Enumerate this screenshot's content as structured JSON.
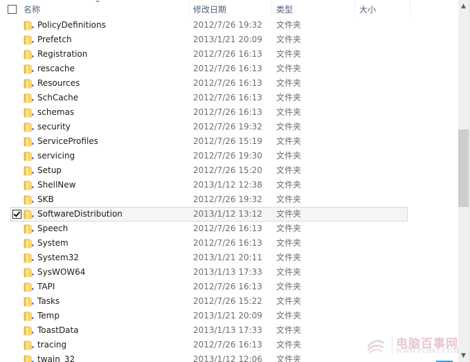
{
  "header": {
    "select_all_checked": false,
    "columns": {
      "name": "名称",
      "date": "修改日期",
      "type": "类型",
      "size": "大小"
    },
    "sort_column": "name",
    "sort_direction": "ascending"
  },
  "rows": [
    {
      "name": "PolicyDefinitions",
      "date": "2012/7/26 19:32",
      "type": "文件夹",
      "size": "",
      "selected": false
    },
    {
      "name": "Prefetch",
      "date": "2013/1/21 20:09",
      "type": "文件夹",
      "size": "",
      "selected": false
    },
    {
      "name": "Registration",
      "date": "2012/7/26 16:13",
      "type": "文件夹",
      "size": "",
      "selected": false
    },
    {
      "name": "rescache",
      "date": "2012/7/26 16:13",
      "type": "文件夹",
      "size": "",
      "selected": false
    },
    {
      "name": "Resources",
      "date": "2012/7/26 16:13",
      "type": "文件夹",
      "size": "",
      "selected": false
    },
    {
      "name": "SchCache",
      "date": "2012/7/26 16:13",
      "type": "文件夹",
      "size": "",
      "selected": false
    },
    {
      "name": "schemas",
      "date": "2012/7/26 16:13",
      "type": "文件夹",
      "size": "",
      "selected": false
    },
    {
      "name": "security",
      "date": "2012/7/26 19:32",
      "type": "文件夹",
      "size": "",
      "selected": false
    },
    {
      "name": "ServiceProfiles",
      "date": "2012/7/26 15:19",
      "type": "文件夹",
      "size": "",
      "selected": false
    },
    {
      "name": "servicing",
      "date": "2012/7/26 19:30",
      "type": "文件夹",
      "size": "",
      "selected": false
    },
    {
      "name": "Setup",
      "date": "2012/7/26 15:20",
      "type": "文件夹",
      "size": "",
      "selected": false
    },
    {
      "name": "ShellNew",
      "date": "2013/1/12 12:38",
      "type": "文件夹",
      "size": "",
      "selected": false
    },
    {
      "name": "SKB",
      "date": "2012/7/26 19:32",
      "type": "文件夹",
      "size": "",
      "selected": false
    },
    {
      "name": "SoftwareDistribution",
      "date": "2013/1/12 13:12",
      "type": "文件夹",
      "size": "",
      "selected": true
    },
    {
      "name": "Speech",
      "date": "2012/7/26 16:13",
      "type": "文件夹",
      "size": "",
      "selected": false
    },
    {
      "name": "System",
      "date": "2012/7/26 16:13",
      "type": "文件夹",
      "size": "",
      "selected": false
    },
    {
      "name": "System32",
      "date": "2013/1/21 20:11",
      "type": "文件夹",
      "size": "",
      "selected": false
    },
    {
      "name": "SysWOW64",
      "date": "2013/1/13 17:33",
      "type": "文件夹",
      "size": "",
      "selected": false
    },
    {
      "name": "TAPI",
      "date": "2012/7/26 16:13",
      "type": "文件夹",
      "size": "",
      "selected": false
    },
    {
      "name": "Tasks",
      "date": "2012/7/26 15:22",
      "type": "文件夹",
      "size": "",
      "selected": false
    },
    {
      "name": "Temp",
      "date": "2013/1/21 20:09",
      "type": "文件夹",
      "size": "",
      "selected": false
    },
    {
      "name": "ToastData",
      "date": "2013/1/13 17:33",
      "type": "文件夹",
      "size": "",
      "selected": false
    },
    {
      "name": "tracing",
      "date": "2012/7/26 16:13",
      "type": "文件夹",
      "size": "",
      "selected": false
    },
    {
      "name": "twain_32",
      "date": "2013/1/12 12:06",
      "type": "文件夹",
      "size": "",
      "selected": false
    }
  ],
  "scrollbar": {
    "up_icon": "chevron-up-icon",
    "down_icon": "chevron-down-icon",
    "position_fraction": 0.45,
    "visible_fraction": 0.23
  },
  "watermark": {
    "title": "电脑百事网",
    "url": "WWW.PC841.COM"
  },
  "colors": {
    "header_text": "#4c607a",
    "folder_yellow": "#f0c64a",
    "selection_bg": "#f5f5f5",
    "selection_border": "#d9d9d9"
  }
}
